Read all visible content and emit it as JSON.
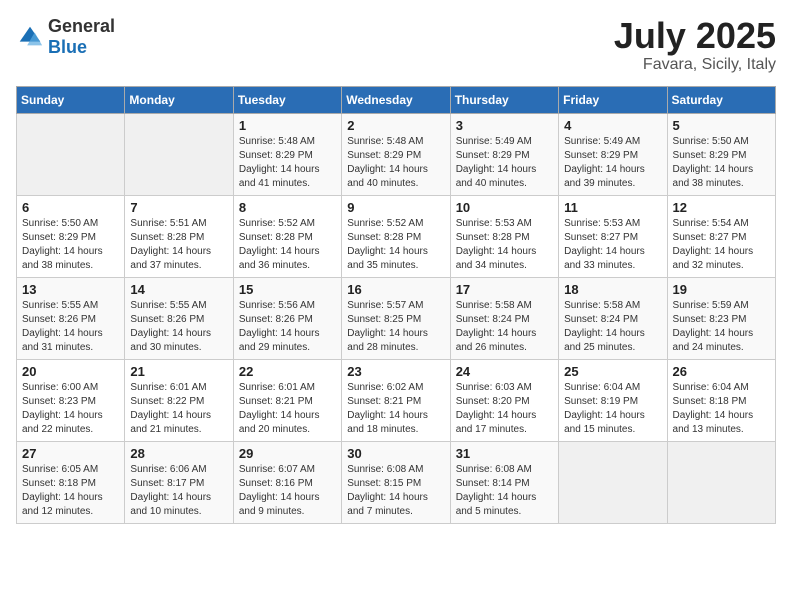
{
  "logo": {
    "general": "General",
    "blue": "Blue"
  },
  "header": {
    "month": "July 2025",
    "location": "Favara, Sicily, Italy"
  },
  "weekdays": [
    "Sunday",
    "Monday",
    "Tuesday",
    "Wednesday",
    "Thursday",
    "Friday",
    "Saturday"
  ],
  "weeks": [
    [
      {
        "day": "",
        "sunrise": "",
        "sunset": "",
        "daylight": ""
      },
      {
        "day": "",
        "sunrise": "",
        "sunset": "",
        "daylight": ""
      },
      {
        "day": "1",
        "sunrise": "Sunrise: 5:48 AM",
        "sunset": "Sunset: 8:29 PM",
        "daylight": "Daylight: 14 hours and 41 minutes."
      },
      {
        "day": "2",
        "sunrise": "Sunrise: 5:48 AM",
        "sunset": "Sunset: 8:29 PM",
        "daylight": "Daylight: 14 hours and 40 minutes."
      },
      {
        "day": "3",
        "sunrise": "Sunrise: 5:49 AM",
        "sunset": "Sunset: 8:29 PM",
        "daylight": "Daylight: 14 hours and 40 minutes."
      },
      {
        "day": "4",
        "sunrise": "Sunrise: 5:49 AM",
        "sunset": "Sunset: 8:29 PM",
        "daylight": "Daylight: 14 hours and 39 minutes."
      },
      {
        "day": "5",
        "sunrise": "Sunrise: 5:50 AM",
        "sunset": "Sunset: 8:29 PM",
        "daylight": "Daylight: 14 hours and 38 minutes."
      }
    ],
    [
      {
        "day": "6",
        "sunrise": "Sunrise: 5:50 AM",
        "sunset": "Sunset: 8:29 PM",
        "daylight": "Daylight: 14 hours and 38 minutes."
      },
      {
        "day": "7",
        "sunrise": "Sunrise: 5:51 AM",
        "sunset": "Sunset: 8:28 PM",
        "daylight": "Daylight: 14 hours and 37 minutes."
      },
      {
        "day": "8",
        "sunrise": "Sunrise: 5:52 AM",
        "sunset": "Sunset: 8:28 PM",
        "daylight": "Daylight: 14 hours and 36 minutes."
      },
      {
        "day": "9",
        "sunrise": "Sunrise: 5:52 AM",
        "sunset": "Sunset: 8:28 PM",
        "daylight": "Daylight: 14 hours and 35 minutes."
      },
      {
        "day": "10",
        "sunrise": "Sunrise: 5:53 AM",
        "sunset": "Sunset: 8:28 PM",
        "daylight": "Daylight: 14 hours and 34 minutes."
      },
      {
        "day": "11",
        "sunrise": "Sunrise: 5:53 AM",
        "sunset": "Sunset: 8:27 PM",
        "daylight": "Daylight: 14 hours and 33 minutes."
      },
      {
        "day": "12",
        "sunrise": "Sunrise: 5:54 AM",
        "sunset": "Sunset: 8:27 PM",
        "daylight": "Daylight: 14 hours and 32 minutes."
      }
    ],
    [
      {
        "day": "13",
        "sunrise": "Sunrise: 5:55 AM",
        "sunset": "Sunset: 8:26 PM",
        "daylight": "Daylight: 14 hours and 31 minutes."
      },
      {
        "day": "14",
        "sunrise": "Sunrise: 5:55 AM",
        "sunset": "Sunset: 8:26 PM",
        "daylight": "Daylight: 14 hours and 30 minutes."
      },
      {
        "day": "15",
        "sunrise": "Sunrise: 5:56 AM",
        "sunset": "Sunset: 8:26 PM",
        "daylight": "Daylight: 14 hours and 29 minutes."
      },
      {
        "day": "16",
        "sunrise": "Sunrise: 5:57 AM",
        "sunset": "Sunset: 8:25 PM",
        "daylight": "Daylight: 14 hours and 28 minutes."
      },
      {
        "day": "17",
        "sunrise": "Sunrise: 5:58 AM",
        "sunset": "Sunset: 8:24 PM",
        "daylight": "Daylight: 14 hours and 26 minutes."
      },
      {
        "day": "18",
        "sunrise": "Sunrise: 5:58 AM",
        "sunset": "Sunset: 8:24 PM",
        "daylight": "Daylight: 14 hours and 25 minutes."
      },
      {
        "day": "19",
        "sunrise": "Sunrise: 5:59 AM",
        "sunset": "Sunset: 8:23 PM",
        "daylight": "Daylight: 14 hours and 24 minutes."
      }
    ],
    [
      {
        "day": "20",
        "sunrise": "Sunrise: 6:00 AM",
        "sunset": "Sunset: 8:23 PM",
        "daylight": "Daylight: 14 hours and 22 minutes."
      },
      {
        "day": "21",
        "sunrise": "Sunrise: 6:01 AM",
        "sunset": "Sunset: 8:22 PM",
        "daylight": "Daylight: 14 hours and 21 minutes."
      },
      {
        "day": "22",
        "sunrise": "Sunrise: 6:01 AM",
        "sunset": "Sunset: 8:21 PM",
        "daylight": "Daylight: 14 hours and 20 minutes."
      },
      {
        "day": "23",
        "sunrise": "Sunrise: 6:02 AM",
        "sunset": "Sunset: 8:21 PM",
        "daylight": "Daylight: 14 hours and 18 minutes."
      },
      {
        "day": "24",
        "sunrise": "Sunrise: 6:03 AM",
        "sunset": "Sunset: 8:20 PM",
        "daylight": "Daylight: 14 hours and 17 minutes."
      },
      {
        "day": "25",
        "sunrise": "Sunrise: 6:04 AM",
        "sunset": "Sunset: 8:19 PM",
        "daylight": "Daylight: 14 hours and 15 minutes."
      },
      {
        "day": "26",
        "sunrise": "Sunrise: 6:04 AM",
        "sunset": "Sunset: 8:18 PM",
        "daylight": "Daylight: 14 hours and 13 minutes."
      }
    ],
    [
      {
        "day": "27",
        "sunrise": "Sunrise: 6:05 AM",
        "sunset": "Sunset: 8:18 PM",
        "daylight": "Daylight: 14 hours and 12 minutes."
      },
      {
        "day": "28",
        "sunrise": "Sunrise: 6:06 AM",
        "sunset": "Sunset: 8:17 PM",
        "daylight": "Daylight: 14 hours and 10 minutes."
      },
      {
        "day": "29",
        "sunrise": "Sunrise: 6:07 AM",
        "sunset": "Sunset: 8:16 PM",
        "daylight": "Daylight: 14 hours and 9 minutes."
      },
      {
        "day": "30",
        "sunrise": "Sunrise: 6:08 AM",
        "sunset": "Sunset: 8:15 PM",
        "daylight": "Daylight: 14 hours and 7 minutes."
      },
      {
        "day": "31",
        "sunrise": "Sunrise: 6:08 AM",
        "sunset": "Sunset: 8:14 PM",
        "daylight": "Daylight: 14 hours and 5 minutes."
      },
      {
        "day": "",
        "sunrise": "",
        "sunset": "",
        "daylight": ""
      },
      {
        "day": "",
        "sunrise": "",
        "sunset": "",
        "daylight": ""
      }
    ]
  ]
}
